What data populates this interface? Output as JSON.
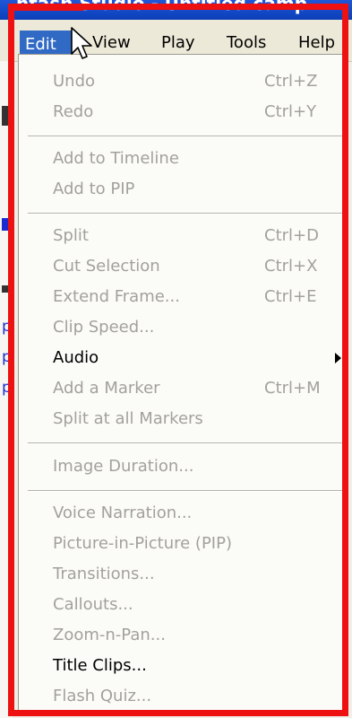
{
  "window": {
    "title_fragment": "ntash Studio - Untitled.camp"
  },
  "menubar": {
    "items": [
      {
        "label": "Edit",
        "underline": "E"
      },
      {
        "label": "View",
        "underline": "V"
      },
      {
        "label": "Play",
        "underline": "P"
      },
      {
        "label": "Tools",
        "underline": "T"
      },
      {
        "label": "Help",
        "underline": "H"
      }
    ]
  },
  "edit_menu": {
    "items": [
      {
        "label": "Undo",
        "shortcut": "Ctrl+Z",
        "enabled": false
      },
      {
        "label": "Redo",
        "shortcut": "Ctrl+Y",
        "enabled": false
      },
      {
        "label": "Add to Timeline",
        "shortcut": "",
        "enabled": false
      },
      {
        "label": "Add to PIP",
        "shortcut": "",
        "enabled": false
      },
      {
        "label": "Split",
        "shortcut": "Ctrl+D",
        "enabled": false
      },
      {
        "label": "Cut Selection",
        "shortcut": "Ctrl+X",
        "enabled": false
      },
      {
        "label": "Extend Frame...",
        "shortcut": "Ctrl+E",
        "enabled": false
      },
      {
        "label": "Clip Speed...",
        "shortcut": "",
        "enabled": false
      },
      {
        "label": "Audio",
        "shortcut": "",
        "enabled": true,
        "submenu": true
      },
      {
        "label": "Add a Marker",
        "shortcut": "Ctrl+M",
        "enabled": false
      },
      {
        "label": "Split at all Markers",
        "shortcut": "",
        "enabled": false
      },
      {
        "label": "Image Duration...",
        "shortcut": "",
        "enabled": false
      },
      {
        "label": "Voice Narration...",
        "shortcut": "",
        "enabled": false
      },
      {
        "label": "Picture-in-Picture (PIP)",
        "shortcut": "",
        "enabled": false
      },
      {
        "label": "Transitions...",
        "shortcut": "",
        "enabled": false
      },
      {
        "label": "Callouts...",
        "shortcut": "",
        "enabled": false
      },
      {
        "label": "Zoom-n-Pan...",
        "shortcut": "",
        "enabled": false
      },
      {
        "label": "Title Clips...",
        "shortcut": "",
        "enabled": true
      },
      {
        "label": "Flash Quiz...",
        "shortcut": "",
        "enabled": false
      }
    ]
  },
  "gutter_marks": [
    "p",
    "p",
    "p"
  ],
  "colors": {
    "highlight": "#ee1111",
    "menu_selected": "#316ac5",
    "disabled_text": "#a4a19b"
  }
}
